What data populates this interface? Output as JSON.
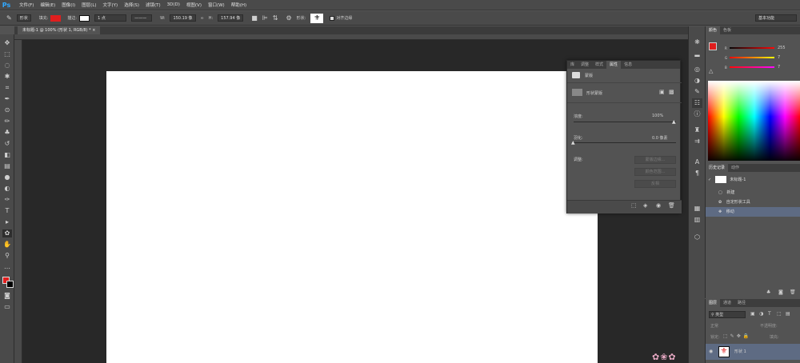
{
  "app": {
    "logo": "Ps"
  },
  "menu": [
    "文件(F)",
    "编辑(E)",
    "图像(I)",
    "图层(L)",
    "文字(Y)",
    "选择(S)",
    "滤镜(T)",
    "3D(D)",
    "视图(V)",
    "窗口(W)",
    "帮助(H)"
  ],
  "options": {
    "mode": "形状",
    "fill_label": "填充:",
    "stroke_label": "描边:",
    "stroke_size": "1 点",
    "w_label": "W:",
    "w_value": "150.19 像",
    "h_label": "H:",
    "h_value": "157.94 像",
    "shape_label": "形状:",
    "align_edges": "对齐边缘",
    "workspace": "基本功能",
    "fill_color": "#e01e1e"
  },
  "document": {
    "tab_title": "未标题-1 @ 100% (形状 1, RGB/8) *",
    "close": "×"
  },
  "properties": {
    "tabs": [
      "库",
      "调整",
      "样式",
      "属性",
      "信息"
    ],
    "active_tab": "属性",
    "mask_label": "蒙版",
    "shape_mask_label": "形状蒙版",
    "density_label": "浓度:",
    "density_value": "100%",
    "feather_label": "羽化:",
    "feather_value": "0.0 像素",
    "refine_label": "调整:",
    "btn_mask_edge": "蒙版边缘...",
    "btn_color_range": "颜色范围...",
    "btn_invert": "反相"
  },
  "color_panel": {
    "tabs": [
      "颜色",
      "色板"
    ],
    "r_label": "R",
    "g_label": "G",
    "b_label": "B",
    "r_value": "255",
    "g_value": "7",
    "b_value": "7",
    "fg": "#e01e1e"
  },
  "history_panel": {
    "tabs": [
      "历史记录",
      "动作"
    ],
    "snapshot": "未标题-1",
    "items": [
      "新建",
      "自定形状工具",
      "移动"
    ]
  },
  "layers_panel": {
    "tabs": [
      "图层",
      "通道",
      "路径"
    ],
    "kind": "类型",
    "blend": "正常",
    "opacity_label": "不透明度:",
    "lock_label": "锁定:",
    "fill_label": "填充:",
    "layer_name": "形状 1"
  }
}
